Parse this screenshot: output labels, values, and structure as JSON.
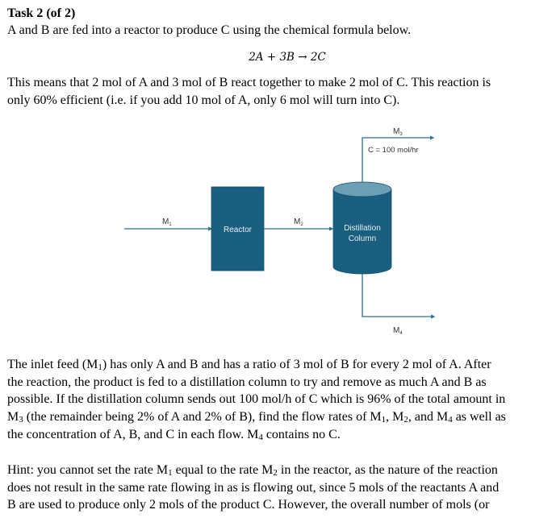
{
  "task": {
    "title": "Task 2 (of 2)"
  },
  "intro": {
    "text": "A and B are fed into a reactor to produce C using the chemical formula below."
  },
  "equation": {
    "text": "2A + 3B  → 2C"
  },
  "meaning": {
    "line1": "This means that 2 mol of A and 3 mol of B react together to make 2 mol of C. This reaction is",
    "line2": "only 60% efficient (i.e. if you add 10 mol of A, only 6 mol will turn into C)."
  },
  "diagram": {
    "colors": {
      "unit_fill": "#1a5e80",
      "cylinder_top": "#6a9fb5",
      "stream_line": "#2f6f8c"
    },
    "reactor": {
      "label": "Reactor"
    },
    "column": {
      "label_line1": "Distillation",
      "label_line2": "Column"
    },
    "streams": {
      "m1": {
        "label": "M",
        "sub": "1"
      },
      "m2": {
        "label": "M",
        "sub": "2"
      },
      "m3": {
        "label": "M",
        "sub": "3",
        "annotation": "C = 100 mol/hr"
      },
      "m4": {
        "label": "M",
        "sub": "4"
      }
    }
  },
  "inlet": {
    "line1_a": "The inlet feed (M",
    "line1_sub": "1",
    "line1_b": ") has only A and B and has a ratio of 3 mol of B for every 2 mol of A. After",
    "line2": "the reaction, the product is fed to a distillation column to try and remove as much A and B as",
    "line3": "possible. If the distillation column sends out 100 mol/h of C which is 96% of the total amount in",
    "line4_a": "M",
    "line4_sub1": "3",
    "line4_b": " (the remainder being 2% of A and 2% of B), find the flow rates of M",
    "line4_sub2": "1",
    "line4_c": ", M",
    "line4_sub3": "2",
    "line4_d": ", and M",
    "line4_sub4": "4",
    "line4_e": " as well as",
    "line5_a": "the concentration of A, B, and C in each flow. M",
    "line5_sub": "4",
    "line5_b": " contains no C."
  },
  "hint": {
    "line1_a": "Hint: you cannot set the rate M",
    "line1_sub1": "1",
    "line1_b": " equal to the rate M",
    "line1_sub2": "2",
    "line1_c": " in the reactor, as the nature of the reaction",
    "line2": "does not result in the same rate flowing in as is flowing out, since 5 mols of the reactants A and",
    "line3": "B are used to produce only 2 mols of the product C.  However, the overall number of mols (or"
  }
}
